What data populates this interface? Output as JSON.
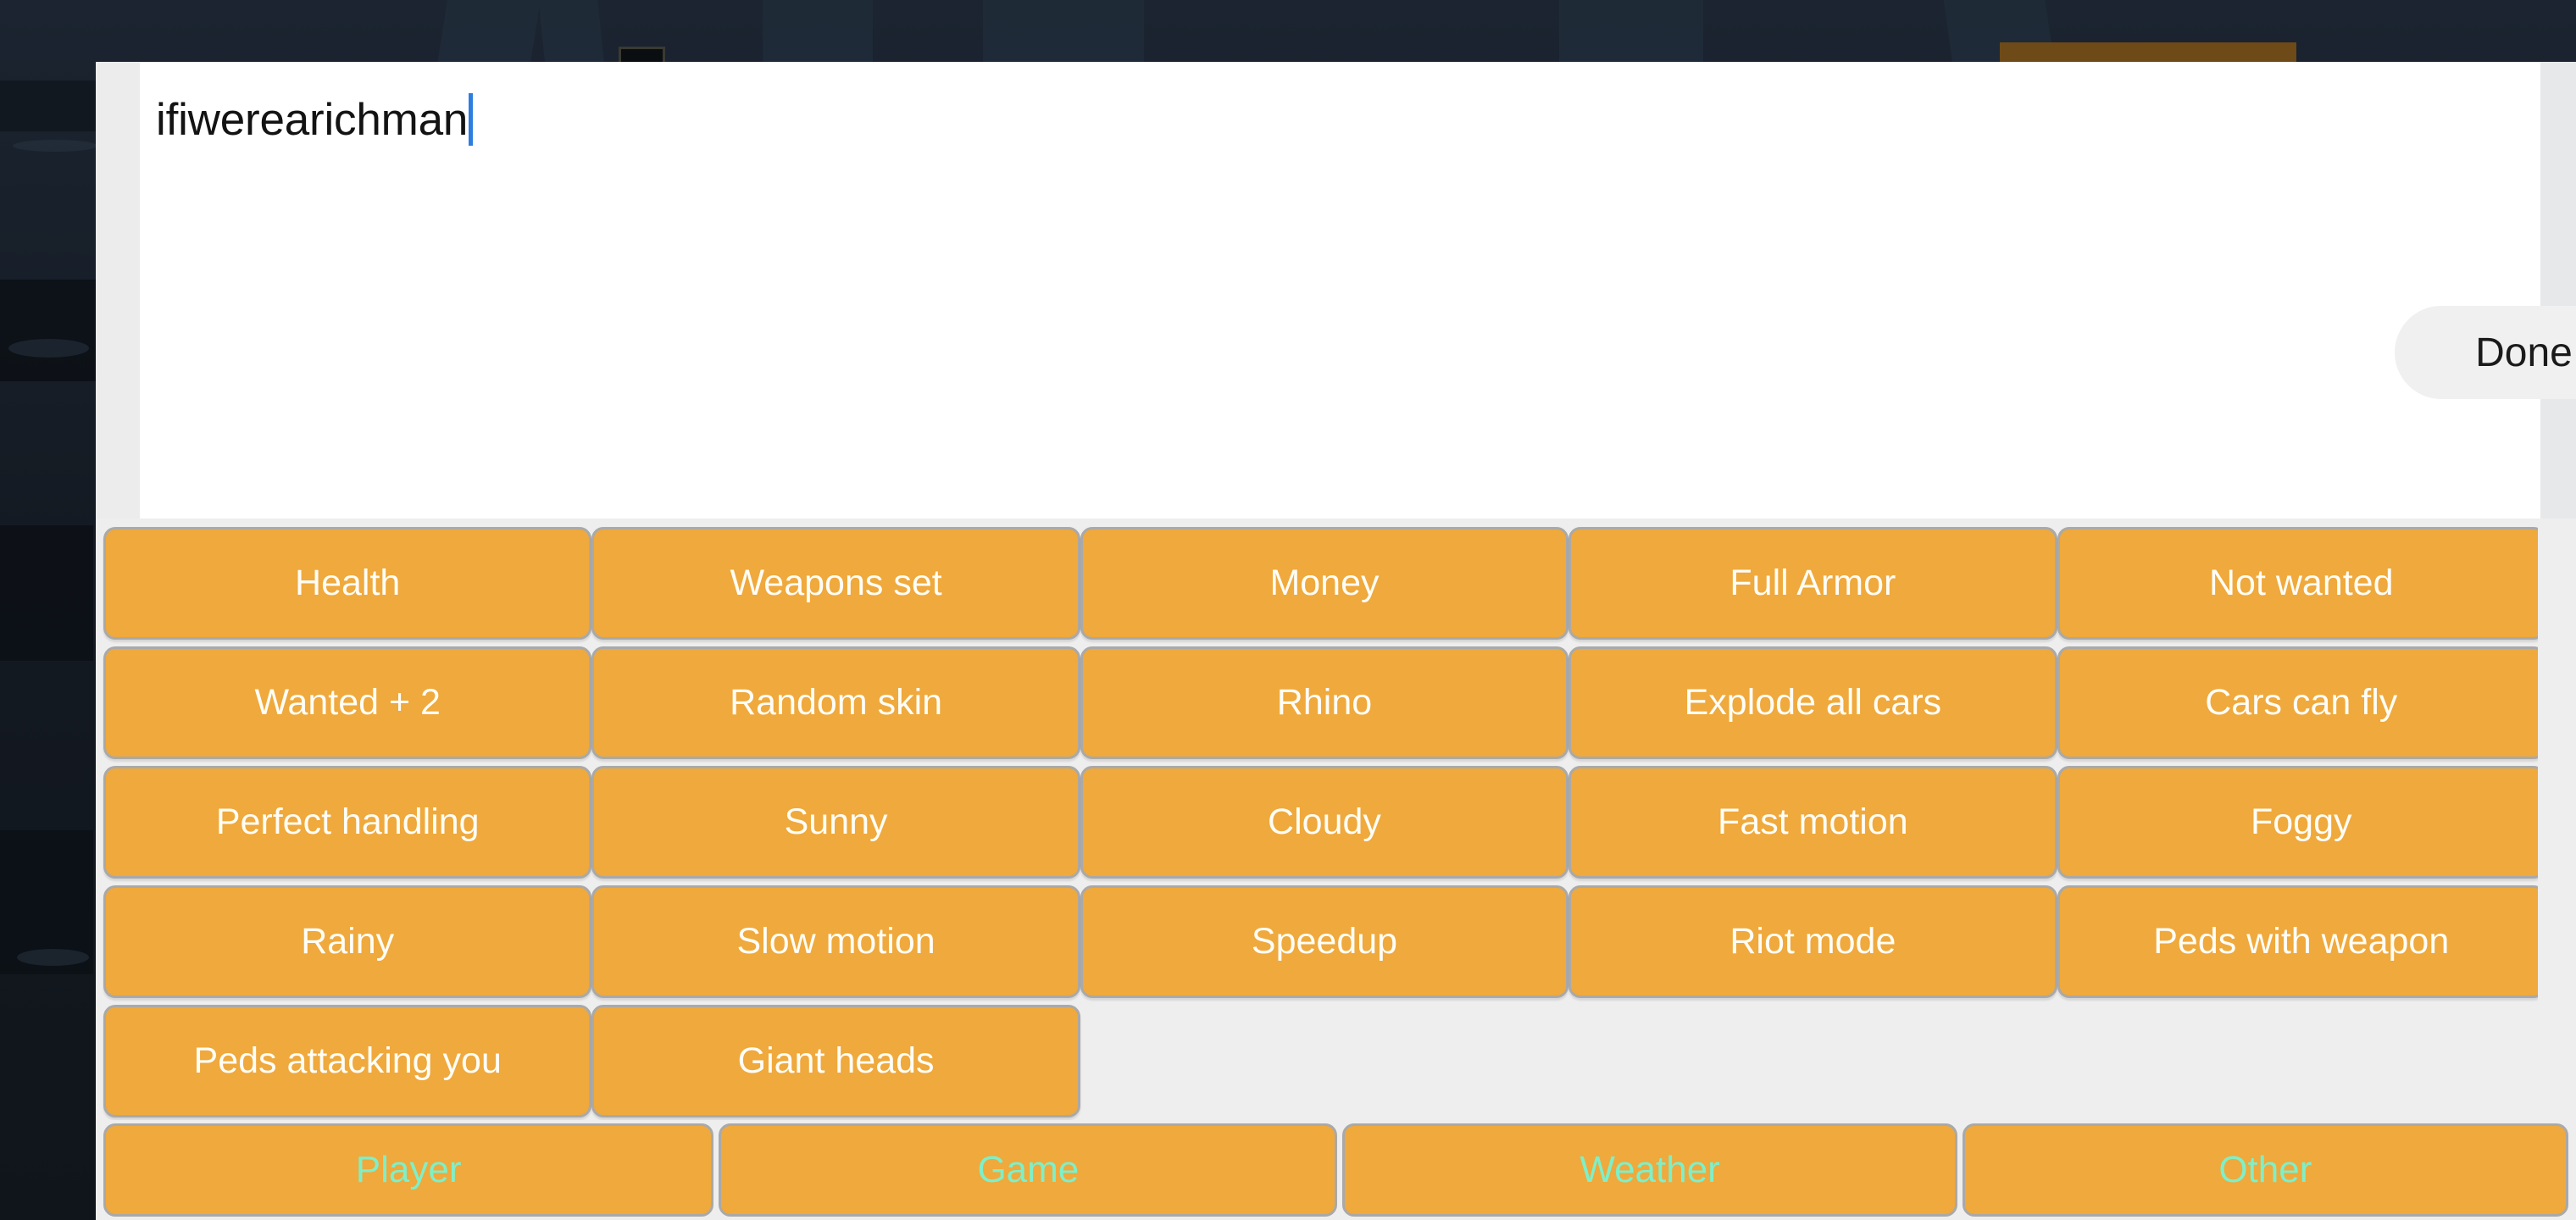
{
  "text_entry": {
    "value": "ifiwerearichman",
    "placeholder": "",
    "done_label": "Done"
  },
  "cheat_grid": {
    "buttons": [
      "Health",
      "Weapons set",
      "Money",
      "Full Armor",
      "Not wanted",
      "Wanted + 2",
      "Random skin",
      "Rhino",
      "Explode all cars",
      "Cars can fly",
      "Perfect handling",
      "Sunny",
      "Cloudy",
      "Fast motion",
      "Foggy",
      "Rainy",
      "Slow motion",
      "Speedup",
      "Riot mode",
      "Peds with weapon",
      "Peds attacking you",
      "Giant heads"
    ]
  },
  "tab_bar": {
    "tabs": [
      {
        "label": "Player"
      },
      {
        "label": "Game"
      },
      {
        "label": "Weather"
      },
      {
        "label": "Other"
      }
    ]
  },
  "colors": {
    "button_orange": "#efa93c",
    "button_border": "#a9a9a9",
    "button_text": "#fffdf6",
    "tab_text": "#7fefc8",
    "panel_white": "#ffffff",
    "grid_background": "#eeeeee",
    "done_background": "#f0f0f0",
    "done_text": "#1a1a1a",
    "caret_blue": "#2f7de1",
    "game_background": "#151c24"
  }
}
